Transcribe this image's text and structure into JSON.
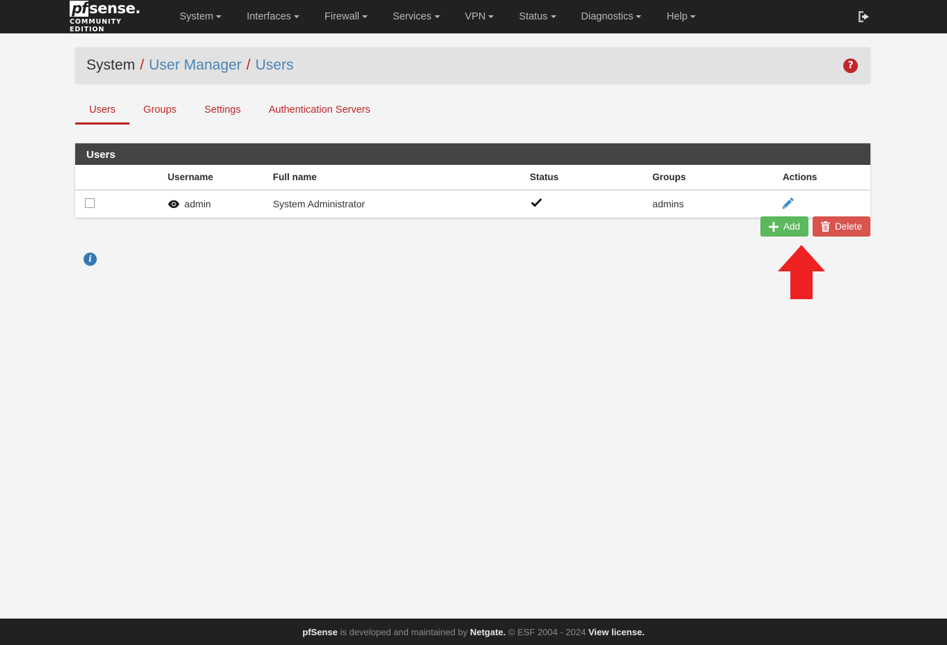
{
  "navbar": {
    "brand": {
      "pf": "pf",
      "sense": "sense.",
      "subtitle": "COMMUNITY EDITION"
    },
    "items": [
      {
        "label": "System",
        "has_caret": true
      },
      {
        "label": "Interfaces",
        "has_caret": true
      },
      {
        "label": "Firewall",
        "has_caret": true
      },
      {
        "label": "Services",
        "has_caret": true
      },
      {
        "label": "VPN",
        "has_caret": true
      },
      {
        "label": "Status",
        "has_caret": true
      },
      {
        "label": "Diagnostics",
        "has_caret": true
      },
      {
        "label": "Help",
        "has_caret": true
      }
    ],
    "logout_icon": "logout-icon",
    "background_color": "#212121"
  },
  "breadcrumb": {
    "root": "System",
    "separator": "/",
    "level2": "User Manager",
    "level3": "Users",
    "help_icon_glyph": "?",
    "help_color": "#c0262b",
    "link_color": "#4c83b3",
    "separator_color": "#c02424"
  },
  "tabs": [
    {
      "label": "Users",
      "active": true
    },
    {
      "label": "Groups",
      "active": false
    },
    {
      "label": "Settings",
      "active": false
    },
    {
      "label": "Authentication Servers",
      "active": false
    }
  ],
  "panel": {
    "heading": "Users",
    "columns": [
      "",
      "Username",
      "Full name",
      "Status",
      "Groups",
      "Actions"
    ],
    "rows": [
      {
        "checked": false,
        "username": "admin",
        "user_icon": "eye-icon",
        "full_name": "System Administrator",
        "status": "✔",
        "groups": "admins",
        "action_icon": "pencil-edit-icon"
      }
    ]
  },
  "buttons": {
    "add_label": "Add",
    "add_icon": "plus-icon",
    "add_color": "#5cb85c",
    "delete_label": "Delete",
    "delete_icon": "trash-icon",
    "delete_color": "#d9534f"
  },
  "info": {
    "icon_glyph": "i",
    "color": "#337ab7"
  },
  "annotation": {
    "type": "arrow-up",
    "color": "#ee2222"
  },
  "footer": {
    "brand": "pfSense",
    "mid": " is developed and maintained by ",
    "company": "Netgate.",
    "copyright": " © ESF 2004 - 2024 ",
    "license_link": "View license."
  }
}
